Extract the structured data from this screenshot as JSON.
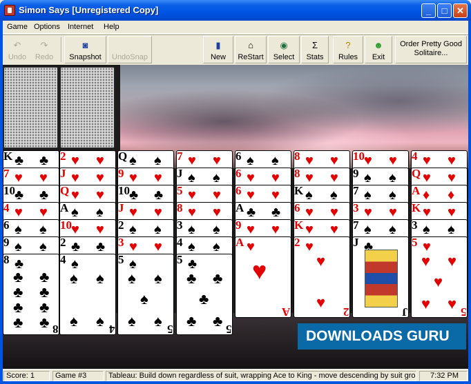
{
  "window": {
    "title": "Simon Says [Unregistered Copy]",
    "controls": [
      "minimize",
      "maximize",
      "close"
    ]
  },
  "menu": [
    "Game",
    "Options",
    "Internet",
    "Help"
  ],
  "toolbar": {
    "undo": "Undo",
    "redo": "Redo",
    "snapshot": "Snapshot",
    "undosnap": "UndoSnap",
    "new": "New",
    "restart": "ReStart",
    "select": "Select",
    "stats": "Stats",
    "rules": "Rules",
    "exit": "Exit",
    "order_line1": "Order Pretty Good",
    "order_line2": "Solitaire..."
  },
  "tableau": [
    {
      "cards": [
        "K",
        "7",
        "10",
        "4",
        "6",
        "9",
        "8"
      ],
      "suits": [
        "♣",
        "♥",
        "♣",
        "♥",
        "♠",
        "♠",
        "♣"
      ],
      "colors": [
        "b",
        "r",
        "b",
        "r",
        "b",
        "b",
        "b"
      ]
    },
    {
      "cards": [
        "2",
        "J",
        "Q",
        "A",
        "10",
        "2",
        "4"
      ],
      "suits": [
        "♥",
        "♥",
        "♥",
        "♠",
        "♥",
        "♣",
        "♠"
      ],
      "colors": [
        "r",
        "r",
        "r",
        "b",
        "r",
        "b",
        "b"
      ]
    },
    {
      "cards": [
        "Q",
        "9",
        "10",
        "J",
        "2",
        "3",
        "5"
      ],
      "suits": [
        "♠",
        "♥",
        "♣",
        "♥",
        "♠",
        "♥",
        "♠"
      ],
      "colors": [
        "b",
        "r",
        "b",
        "r",
        "b",
        "r",
        "b"
      ]
    },
    {
      "cards": [
        "7",
        "J",
        "5",
        "8",
        "3",
        "4",
        "5"
      ],
      "suits": [
        "♥",
        "♠",
        "♥",
        "♥",
        "♠",
        "♠",
        "♣"
      ],
      "colors": [
        "r",
        "b",
        "r",
        "r",
        "b",
        "b",
        "b"
      ]
    },
    {
      "cards": [
        "6",
        "6",
        "6",
        "A",
        "9",
        "A"
      ],
      "suits": [
        "♠",
        "♥",
        "♥",
        "♣",
        "♥",
        "♥"
      ],
      "colors": [
        "b",
        "r",
        "r",
        "b",
        "r",
        "r"
      ]
    },
    {
      "cards": [
        "8",
        "8",
        "K",
        "6",
        "K",
        "2"
      ],
      "suits": [
        "♥",
        "♥",
        "♠",
        "♥",
        "♥",
        "♥"
      ],
      "colors": [
        "r",
        "r",
        "b",
        "r",
        "r",
        "r"
      ]
    },
    {
      "cards": [
        "10",
        "9",
        "7",
        "3",
        "7",
        "J"
      ],
      "suits": [
        "♥",
        "♠",
        "♠",
        "♥",
        "♠",
        "♣"
      ],
      "colors": [
        "r",
        "b",
        "b",
        "r",
        "b",
        "b"
      ]
    },
    {
      "cards": [
        "4",
        "Q",
        "A",
        "K",
        "3",
        "5"
      ],
      "suits": [
        "♥",
        "♥",
        "♦",
        "♥",
        "♠",
        "♥"
      ],
      "colors": [
        "r",
        "r",
        "r",
        "r",
        "b",
        "r"
      ]
    }
  ],
  "status": {
    "score": "Score: 1",
    "game": "Game #3",
    "message": "Tableau: Build down regardless of suit, wrapping Ace to King - move descending by suit groups",
    "time": "7:32 PM"
  },
  "watermark": "DOWNLOADS  GURU"
}
